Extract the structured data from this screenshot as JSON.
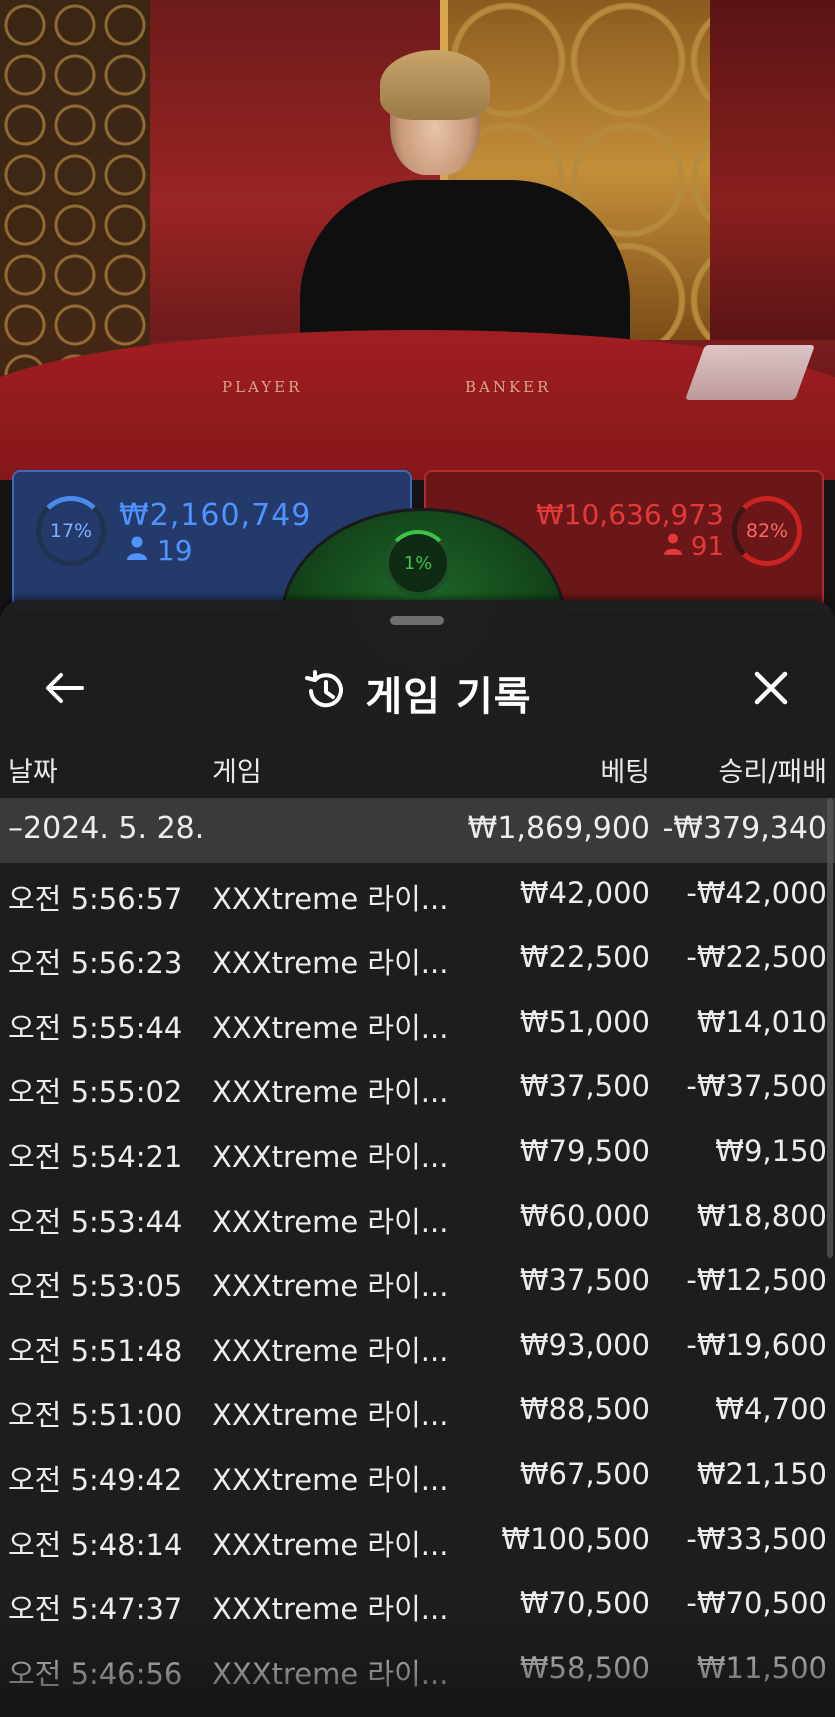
{
  "video": {
    "felt_left": "PLAYER",
    "felt_right": "BANKER"
  },
  "bets": {
    "player": {
      "percent": "17%",
      "amount": "₩2,160,749",
      "count": "19",
      "color": "#4f93ff"
    },
    "tie": {
      "percent": "1%",
      "color": "#3ec24a"
    },
    "banker": {
      "percent": "82%",
      "amount": "₩10,636,973",
      "count": "91",
      "color": "#e23a3a"
    }
  },
  "history": {
    "title": "게임 기록",
    "title_icon": "history-icon",
    "back_icon": "arrow-left-icon",
    "close_icon": "close-icon",
    "columns": {
      "date": "날짜",
      "game": "게임",
      "bet": "베팅",
      "result": "승리/패배"
    },
    "day": {
      "label": "–2024. 5. 28.",
      "bet": "₩1,869,900",
      "result": "-₩379,340"
    },
    "rows": [
      {
        "time": "오전 5:56:57",
        "game": "XXXtreme 라이...",
        "bet": "₩42,000",
        "result": "-₩42,000"
      },
      {
        "time": "오전 5:56:23",
        "game": "XXXtreme 라이...",
        "bet": "₩22,500",
        "result": "-₩22,500"
      },
      {
        "time": "오전 5:55:44",
        "game": "XXXtreme 라이...",
        "bet": "₩51,000",
        "result": "₩14,010"
      },
      {
        "time": "오전 5:55:02",
        "game": "XXXtreme 라이...",
        "bet": "₩37,500",
        "result": "-₩37,500"
      },
      {
        "time": "오전 5:54:21",
        "game": "XXXtreme 라이...",
        "bet": "₩79,500",
        "result": "₩9,150"
      },
      {
        "time": "오전 5:53:44",
        "game": "XXXtreme 라이...",
        "bet": "₩60,000",
        "result": "₩18,800"
      },
      {
        "time": "오전 5:53:05",
        "game": "XXXtreme 라이...",
        "bet": "₩37,500",
        "result": "-₩12,500"
      },
      {
        "time": "오전 5:51:48",
        "game": "XXXtreme 라이...",
        "bet": "₩93,000",
        "result": "-₩19,600"
      },
      {
        "time": "오전 5:51:00",
        "game": "XXXtreme 라이...",
        "bet": "₩88,500",
        "result": "₩4,700"
      },
      {
        "time": "오전 5:49:42",
        "game": "XXXtreme 라이...",
        "bet": "₩67,500",
        "result": "₩21,150"
      },
      {
        "time": "오전 5:48:14",
        "game": "XXXtreme 라이...",
        "bet": "₩100,500",
        "result": "-₩33,500"
      },
      {
        "time": "오전 5:47:37",
        "game": "XXXtreme 라이...",
        "bet": "₩70,500",
        "result": "-₩70,500"
      },
      {
        "time": "오전 5:46:56",
        "game": "XXXtreme 라이...",
        "bet": "₩58,500",
        "result": "₩11,500"
      }
    ]
  }
}
